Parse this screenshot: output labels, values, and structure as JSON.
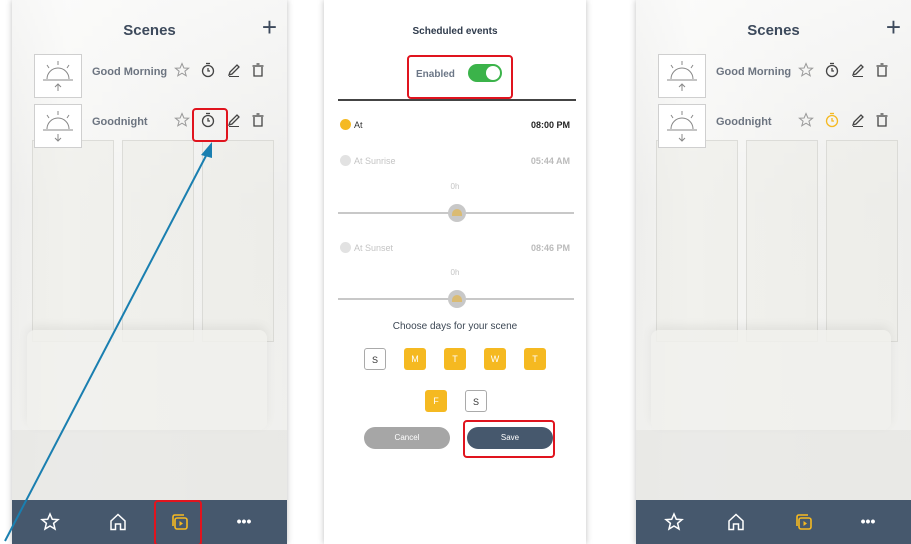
{
  "screen1": {
    "title": "Scenes",
    "add_label": "+",
    "scenes": [
      {
        "name": "Good Morning",
        "icon": "sunrise-icon"
      },
      {
        "name": "Goodnight",
        "icon": "sunset-icon"
      }
    ],
    "nav": [
      "star-icon",
      "home-icon",
      "scenes-icon",
      "more-icon"
    ],
    "more_label": "•••"
  },
  "screen2": {
    "title": "Scheduled events",
    "enabled_label": "Enabled",
    "enabled": true,
    "at": {
      "label": "At",
      "time": "08:00 PM"
    },
    "sunrise": {
      "label": "At Sunrise",
      "time": "05:44 AM",
      "offset": "0h"
    },
    "sunset": {
      "label": "At Sunset",
      "time": "08:46 PM",
      "offset": "0h"
    },
    "choose_label": "Choose days for your scene",
    "days": [
      {
        "label": "S",
        "selected": false
      },
      {
        "label": "M",
        "selected": true
      },
      {
        "label": "T",
        "selected": true
      },
      {
        "label": "W",
        "selected": true
      },
      {
        "label": "T",
        "selected": true
      },
      {
        "label": "F",
        "selected": true
      },
      {
        "label": "S",
        "selected": false
      }
    ],
    "cancel_label": "Cancel",
    "save_label": "Save"
  },
  "screen3": {
    "title": "Scenes",
    "add_label": "+",
    "scenes": [
      {
        "name": "Good Morning",
        "icon": "sunrise-icon"
      },
      {
        "name": "Goodnight",
        "icon": "sunset-icon",
        "timer_active": true
      }
    ],
    "more_label": "•••"
  },
  "colors": {
    "accent": "#f5b921",
    "navbar": "#46586d",
    "highlight": "#e0141e",
    "arrow": "#1a7fb0",
    "toggle_on": "#3bb34a"
  }
}
